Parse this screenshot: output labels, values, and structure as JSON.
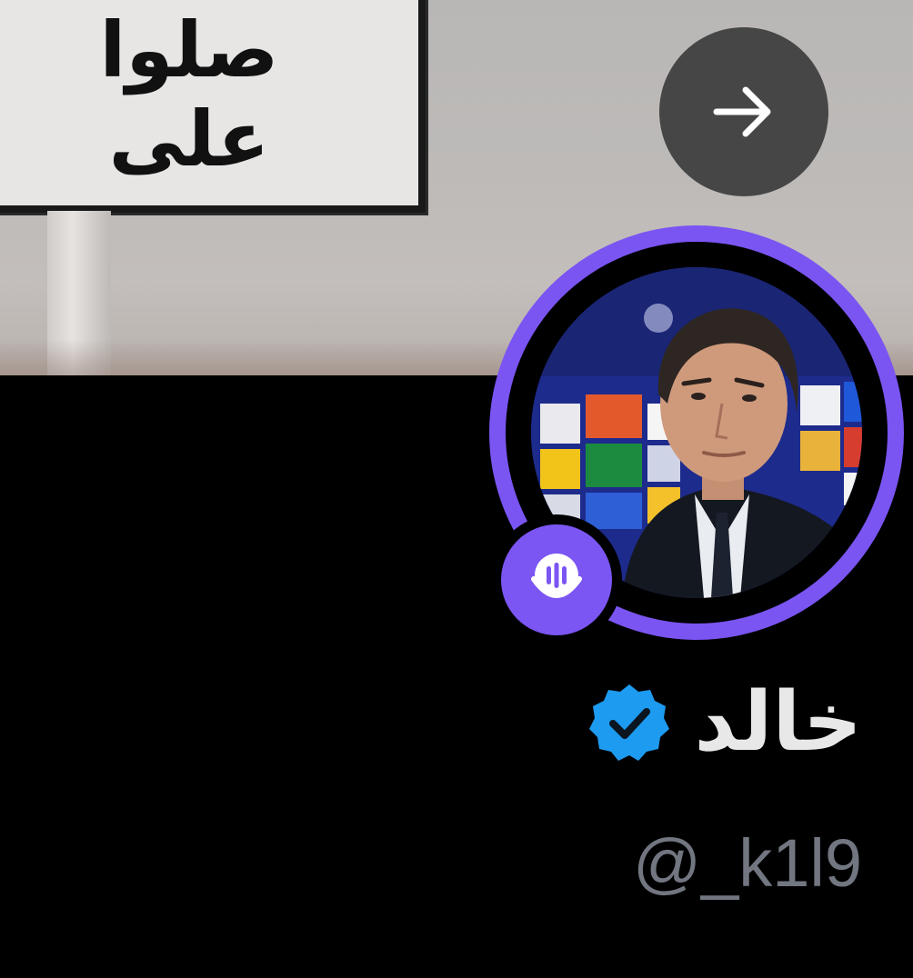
{
  "banner": {
    "sign_text": "صلوا على",
    "description_icon": "road-sign-banner"
  },
  "navigation": {
    "next_icon": "arrow-right-icon"
  },
  "profile": {
    "avatar_icon": "profile-avatar",
    "ring_color": "#7a55f2",
    "spaces_icon": "spaces-microphone-icon",
    "display_name": "خالد",
    "verified_icon": "verified-badge-icon",
    "verified_color": "#1d9bf0",
    "handle": "@_k1l9"
  }
}
